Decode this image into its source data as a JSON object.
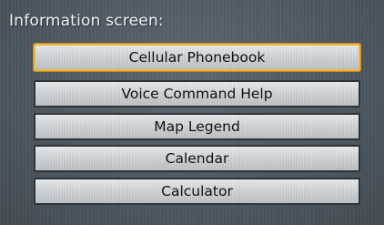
{
  "screen": {
    "title": "Information screen:"
  },
  "menu": {
    "items": [
      {
        "label": "Cellular Phonebook",
        "selected": true
      },
      {
        "label": "Voice Command Help",
        "selected": false
      },
      {
        "label": "Map Legend",
        "selected": false
      },
      {
        "label": "Calendar",
        "selected": false
      },
      {
        "label": "Calculator",
        "selected": false
      }
    ]
  },
  "colors": {
    "background": "#4f5a63",
    "button_face": "#cfd4d8",
    "selection_highlight": "#f0b63a",
    "title_text": "#f2f2f2",
    "button_text": "#111111"
  }
}
